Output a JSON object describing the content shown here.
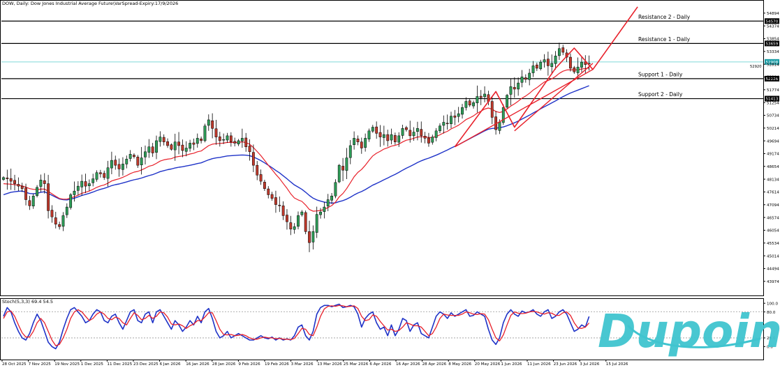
{
  "header": {
    "title": "DOW, Daily:  Dow Jones Industrial Average Future\\VarSpread-Expiry:17/9/2026"
  },
  "stoch_label": "Stoch(5,3,3) 69.4 54.5",
  "brand": {
    "logo_text": "Dupoin",
    "color": "#3fc4cf"
  },
  "colors": {
    "bull": "#2e9d58",
    "bear": "#c0392b",
    "ma_fast": "#e8202a",
    "ma_slow": "#1f33c8",
    "stoch_k": "#1f33c8",
    "stoch_d": "#e8202a",
    "current_line": "#7fd6d6",
    "level_line": "#000000",
    "projection": "#e8202a"
  },
  "chart_data": [
    {
      "type": "candlestick",
      "ylim": [
        43400,
        55400
      ],
      "yticks": [
        43974,
        44494,
        45014,
        45534,
        46054,
        46574,
        47094,
        47614,
        48134,
        48654,
        49174,
        49694,
        50214,
        50734,
        51254,
        51774,
        52294,
        52814,
        53334,
        53854,
        54374,
        54894
      ],
      "x_labels": [
        "28 Oct 2025",
        "7 Nov 2025",
        "19 Nov 2025",
        "1 Dec 2025",
        "11 Dec 2025",
        "23 Dec 2025",
        "6 Jan 2026",
        "16 Jan 2026",
        "28 Jan 2026",
        "9 Feb 2026",
        "19 Feb 2026",
        "3 Mar 2026",
        "13 Mar 2026",
        "25 Mar 2026",
        "6 Apr 2026",
        "16 Apr 2026",
        "28 Apr 2026",
        "8 May 2026",
        "20 May 2026",
        "1 Jun 2026",
        "11 Jun 2026",
        "23 Jun 2026",
        "3 Jul 2026",
        "15 Jul 2026"
      ],
      "closes": [
        48200,
        48150,
        48050,
        47950,
        47850,
        47750,
        47300,
        47050,
        47450,
        47800,
        48100,
        47950,
        46850,
        46600,
        46300,
        46200,
        46650,
        47000,
        47500,
        47650,
        47850,
        48050,
        47850,
        47950,
        48150,
        48400,
        48350,
        48200,
        48600,
        48900,
        48700,
        48550,
        48750,
        48950,
        49150,
        49050,
        48700,
        49000,
        49250,
        49450,
        49200,
        49700,
        49850,
        49650,
        49500,
        49350,
        49650,
        49500,
        49300,
        49400,
        49600,
        49550,
        49800,
        49700,
        50300,
        50550,
        50200,
        49850,
        49700,
        49750,
        49900,
        49650,
        49600,
        49700,
        49800,
        49450,
        49250,
        48700,
        48300,
        48050,
        47750,
        47500,
        47350,
        47100,
        47050,
        46650,
        46400,
        46100,
        46200,
        46650,
        46800,
        46000,
        45550,
        46000,
        46700,
        46800,
        47000,
        47300,
        47450,
        48000,
        48700,
        48500,
        49000,
        49500,
        49800,
        49650,
        49400,
        49800,
        50100,
        50250,
        50000,
        49850,
        49950,
        49700,
        49950,
        49650,
        49900,
        50200,
        50150,
        49900,
        50050,
        50200,
        49900,
        49800,
        49600,
        49850,
        50100,
        50300,
        50450,
        50400,
        50700,
        50650,
        50800,
        51050,
        51300,
        51150,
        51250,
        51500,
        51450,
        51600,
        51300,
        50650,
        50150,
        50450,
        51050,
        51550,
        51900,
        51800,
        52050,
        52300,
        52200,
        52450,
        52750,
        52650,
        52900,
        53000,
        52750,
        52850,
        53150,
        53450,
        53300,
        53100,
        52650,
        52500,
        52700,
        52900,
        52800,
        52850
      ],
      "series": [
        {
          "name": "",
          "values": [
            47500,
            47550,
            47600,
            47620,
            47640,
            47650,
            47600,
            47550,
            47540,
            47560,
            47600,
            47620,
            47550,
            47480,
            47400,
            47330,
            47300,
            47290,
            47320,
            47360,
            47410,
            47470,
            47510,
            47560,
            47610,
            47670,
            47720,
            47760,
            47810,
            47870,
            47910,
            47940,
            47980,
            48020,
            48070,
            48110,
            48140,
            48180,
            48230,
            48280,
            48320,
            48380,
            48440,
            48480,
            48520,
            48550,
            48590,
            48620,
            48640,
            48670,
            48700,
            48730,
            48770,
            48800,
            48860,
            48920,
            48970,
            49000,
            49020,
            49050,
            49080,
            49090,
            49100,
            49110,
            49120,
            49110,
            49090,
            49040,
            48970,
            48890,
            48800,
            48700,
            48600,
            48490,
            48390,
            48270,
            48150,
            48020,
            47900,
            47810,
            47720,
            47600,
            47470,
            47360,
            47290,
            47240,
            47200,
            47180,
            47160,
            47170,
            47220,
            47260,
            47320,
            47400,
            47490,
            47570,
            47630,
            47710,
            47800,
            47890,
            47960,
            48030,
            48110,
            48180,
            48260,
            48330,
            48410,
            48500,
            48580,
            48650,
            48730,
            48810,
            48880,
            48940,
            48990,
            49050,
            49110,
            49180,
            49250,
            49320,
            49400,
            49470,
            49540,
            49620,
            49700,
            49780,
            49860,
            49940,
            50020,
            50100,
            50170,
            50200,
            50210,
            50230,
            50260,
            50310,
            50370,
            50430,
            50500,
            50580,
            50660,
            50740,
            50830,
            50910,
            51000,
            51080,
            51160,
            51240,
            51320,
            51410,
            51490,
            51570,
            51640,
            51700,
            51760,
            51820,
            51880,
            51940
          ]
        },
        {
          "name": "",
          "values": [
            47950,
            47940,
            47930,
            47910,
            47890,
            47860,
            47810,
            47750,
            47720,
            47710,
            47730,
            47730,
            47640,
            47540,
            47440,
            47350,
            47320,
            47320,
            47370,
            47420,
            47480,
            47560,
            47600,
            47650,
            47720,
            47800,
            47860,
            47900,
            47970,
            48060,
            48110,
            48150,
            48210,
            48280,
            48360,
            48420,
            48450,
            48510,
            48580,
            48660,
            48700,
            48780,
            48870,
            48920,
            48950,
            48970,
            49030,
            49060,
            49080,
            49110,
            49160,
            49190,
            49250,
            49280,
            49390,
            49500,
            49560,
            49580,
            49590,
            49600,
            49630,
            49630,
            49620,
            49630,
            49650,
            49620,
            49560,
            49420,
            49260,
            49090,
            48900,
            48700,
            48520,
            48330,
            48160,
            47960,
            47760,
            47540,
            47370,
            47290,
            47230,
            47080,
            46900,
            46830,
            46840,
            46860,
            46900,
            46980,
            47060,
            47200,
            47410,
            47550,
            47750,
            47990,
            48230,
            48410,
            48530,
            48700,
            48900,
            49080,
            49190,
            49270,
            49360,
            49410,
            49480,
            49510,
            49560,
            49650,
            49720,
            49750,
            49800,
            49850,
            49860,
            49860,
            49830,
            49830,
            49870,
            49940,
            50020,
            50080,
            50180,
            50250,
            50330,
            50440,
            50560,
            50630,
            50710,
            50820,
            50900,
            50990,
            51030,
            50980,
            50890,
            50850,
            50890,
            50990,
            51110,
            51200,
            51310,
            51430,
            51520,
            51630,
            51760,
            51860,
            51980,
            52090,
            52150,
            52220,
            52320,
            52440,
            52530,
            52580,
            52590,
            52580,
            52590,
            52620,
            52640,
            52660
          ]
        }
      ],
      "levels": [
        {
          "name": "Resistance 2 - Daily",
          "value": 54570,
          "tag": "54570"
        },
        {
          "name": "Resistance 1 - Daily",
          "value": 53659,
          "tag": "53659"
        },
        {
          "name": "Support 1 - Daily",
          "value": 52226,
          "tag": "52226"
        },
        {
          "name": "Support 2 - Daily",
          "value": 51413,
          "tag": "51413"
        }
      ],
      "current_price": {
        "value": 52908,
        "tag": "52908",
        "sub_tag": "52920"
      },
      "projection_path": [
        {
          "i": 121,
          "v": 49450
        },
        {
          "i": 132,
          "v": 51700
        },
        {
          "i": 137,
          "v": 50250
        },
        {
          "i": 148,
          "v": 52650
        },
        {
          "i": 153,
          "v": 53470
        },
        {
          "i": 158,
          "v": 52600
        },
        {
          "i": 170,
          "v": 55150
        }
      ],
      "projection_channel": [
        {
          "i": 121,
          "v": 49450
        },
        {
          "i": 158,
          "v": 52600
        },
        {
          "i": 137,
          "v": 50100
        },
        {
          "i": 158,
          "v": 52850
        }
      ]
    },
    {
      "type": "line",
      "ylim": [
        -30,
        110
      ],
      "yticks": [
        100.0,
        80.0,
        20.0,
        0.0
      ],
      "levels": [
        80,
        20
      ],
      "series": [
        {
          "name": "",
          "values": [
            70,
            90,
            80,
            55,
            35,
            20,
            15,
            30,
            55,
            75,
            60,
            35,
            10,
            0,
            -5,
            10,
            40,
            65,
            85,
            90,
            80,
            70,
            55,
            60,
            75,
            85,
            80,
            60,
            55,
            70,
            75,
            55,
            40,
            60,
            80,
            85,
            60,
            55,
            75,
            80,
            55,
            80,
            85,
            70,
            55,
            40,
            60,
            50,
            35,
            45,
            60,
            50,
            70,
            55,
            80,
            88,
            65,
            35,
            20,
            25,
            35,
            20,
            25,
            30,
            25,
            20,
            15,
            15,
            20,
            25,
            20,
            18,
            22,
            15,
            20,
            15,
            18,
            15,
            25,
            45,
            50,
            25,
            15,
            35,
            75,
            90,
            95,
            95,
            92,
            95,
            98,
            90,
            92,
            95,
            92,
            75,
            45,
            65,
            75,
            80,
            55,
            40,
            45,
            25,
            50,
            25,
            40,
            65,
            60,
            35,
            50,
            55,
            30,
            25,
            20,
            45,
            70,
            80,
            75,
            65,
            78,
            70,
            75,
            80,
            85,
            70,
            72,
            80,
            75,
            70,
            40,
            15,
            5,
            20,
            55,
            75,
            85,
            75,
            70,
            82,
            78,
            80,
            85,
            75,
            70,
            80,
            85,
            65,
            70,
            80,
            85,
            75,
            55,
            35,
            40,
            50,
            45,
            69.4
          ]
        },
        {
          "name": "",
          "values": [
            65,
            80,
            82,
            70,
            50,
            32,
            22,
            22,
            35,
            55,
            65,
            55,
            35,
            15,
            2,
            5,
            20,
            40,
            65,
            80,
            85,
            80,
            70,
            60,
            65,
            75,
            80,
            75,
            65,
            62,
            68,
            65,
            55,
            50,
            65,
            78,
            72,
            62,
            65,
            72,
            65,
            70,
            80,
            78,
            68,
            52,
            50,
            52,
            48,
            42,
            48,
            52,
            60,
            60,
            68,
            78,
            78,
            60,
            40,
            28,
            27,
            28,
            25,
            26,
            28,
            25,
            20,
            17,
            17,
            20,
            22,
            20,
            20,
            18,
            19,
            17,
            17,
            16,
            19,
            30,
            42,
            40,
            28,
            25,
            45,
            70,
            87,
            93,
            94,
            93,
            95,
            94,
            92,
            93,
            94,
            88,
            70,
            60,
            62,
            73,
            70,
            58,
            48,
            38,
            40,
            35,
            37,
            45,
            55,
            52,
            48,
            48,
            45,
            35,
            25,
            30,
            45,
            65,
            75,
            73,
            72,
            72,
            72,
            75,
            80,
            78,
            75,
            74,
            76,
            75,
            62,
            40,
            20,
            13,
            27,
            50,
            72,
            80,
            77,
            76,
            77,
            80,
            81,
            80,
            77,
            75,
            78,
            77,
            72,
            72,
            78,
            80,
            72,
            55,
            43,
            42,
            45,
            54.5
          ]
        }
      ]
    }
  ]
}
